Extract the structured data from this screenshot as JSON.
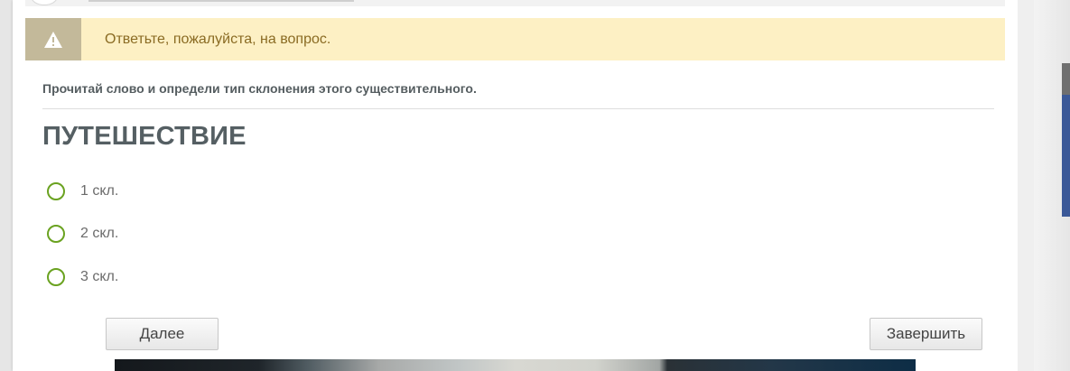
{
  "warning": {
    "icon": "warning-icon",
    "message": "Ответьте, пожалуйста, на вопрос."
  },
  "question": {
    "prompt": "Прочитай слово и определи тип склонения этого существительного.",
    "word": "ПУТЕШЕСТВИЕ",
    "options": [
      {
        "label": "1 скл."
      },
      {
        "label": "2 скл."
      },
      {
        "label": "3 скл."
      }
    ]
  },
  "buttons": {
    "next_label": "Далее",
    "finish_label": "Завершить"
  },
  "colors": {
    "warning_bg": "#fdf0c4",
    "warning_icon_bg": "#c3b99a",
    "warning_text": "#8a6b23",
    "radio_border": "#6aa220",
    "heading": "#555f63"
  }
}
